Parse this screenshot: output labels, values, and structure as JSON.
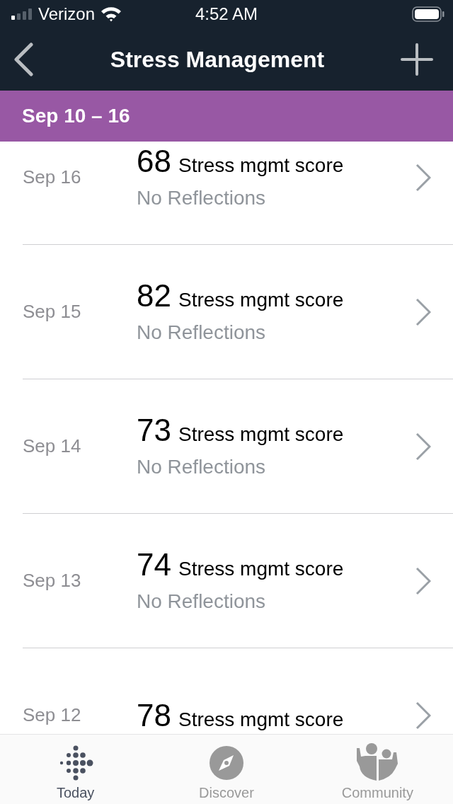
{
  "status_bar": {
    "carrier": "Verizon",
    "time": "4:52 AM"
  },
  "nav": {
    "title": "Stress Management"
  },
  "week_header": {
    "label": "Sep 10 – 16"
  },
  "days": [
    {
      "date": "Sep 16",
      "score": "68",
      "score_label": "Stress mgmt score",
      "reflections": "No Reflections"
    },
    {
      "date": "Sep 15",
      "score": "82",
      "score_label": "Stress mgmt score",
      "reflections": "No Reflections"
    },
    {
      "date": "Sep 14",
      "score": "73",
      "score_label": "Stress mgmt score",
      "reflections": "No Reflections"
    },
    {
      "date": "Sep 13",
      "score": "74",
      "score_label": "Stress mgmt score",
      "reflections": "No Reflections"
    },
    {
      "date": "Sep 12",
      "score": "78",
      "score_label": "Stress mgmt score"
    }
  ],
  "tab_bar": [
    {
      "kind": "today",
      "label": "Today",
      "selected": true
    },
    {
      "kind": "discover",
      "label": "Discover",
      "selected": false
    },
    {
      "kind": "community",
      "label": "Community",
      "selected": false
    }
  ]
}
